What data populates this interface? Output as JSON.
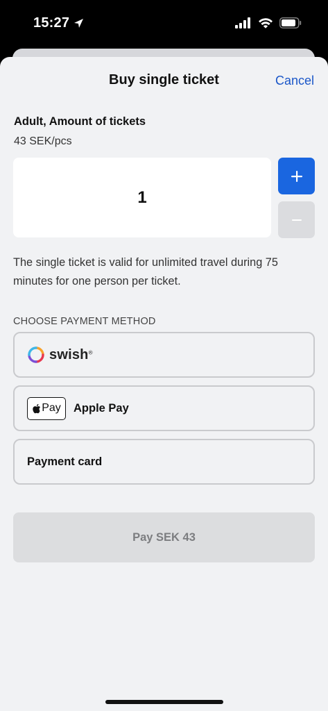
{
  "status_bar": {
    "time": "15:27",
    "icons": [
      "location-arrow-icon",
      "signal-icon",
      "wifi-icon",
      "battery-icon"
    ]
  },
  "sheet": {
    "title": "Buy single ticket",
    "cancel_label": "Cancel"
  },
  "ticket": {
    "label": "Adult, Amount of tickets",
    "price": "43 SEK/pcs",
    "quantity": "1",
    "plus_symbol": "+",
    "minus_symbol": "−",
    "info": "The single ticket is valid for unlimited travel during 75 minutes for one person per ticket."
  },
  "payment": {
    "heading": "CHOOSE PAYMENT METHOD",
    "options": [
      {
        "name": "swish",
        "logo_text": "swish",
        "logo_mark": "®"
      },
      {
        "name": "apple-pay",
        "badge_text": "Pay",
        "label": "Apple Pay"
      },
      {
        "name": "payment-card",
        "label": "Payment card"
      }
    ],
    "pay_button_label": "Pay SEK 43"
  },
  "colors": {
    "accent": "#1a66e0",
    "link": "#1a56c8",
    "sheet_background": "#f1f2f4",
    "disabled_button": "#dcdddf"
  }
}
